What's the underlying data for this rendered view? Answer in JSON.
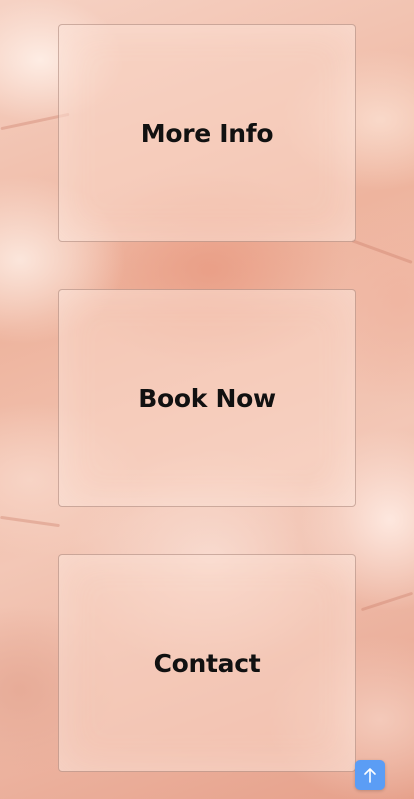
{
  "cards": [
    {
      "label": "More Info"
    },
    {
      "label": "Book Now"
    },
    {
      "label": "Contact"
    }
  ],
  "scroll_top": {
    "icon": "arrow-up-icon",
    "color": "#5b9df5"
  }
}
